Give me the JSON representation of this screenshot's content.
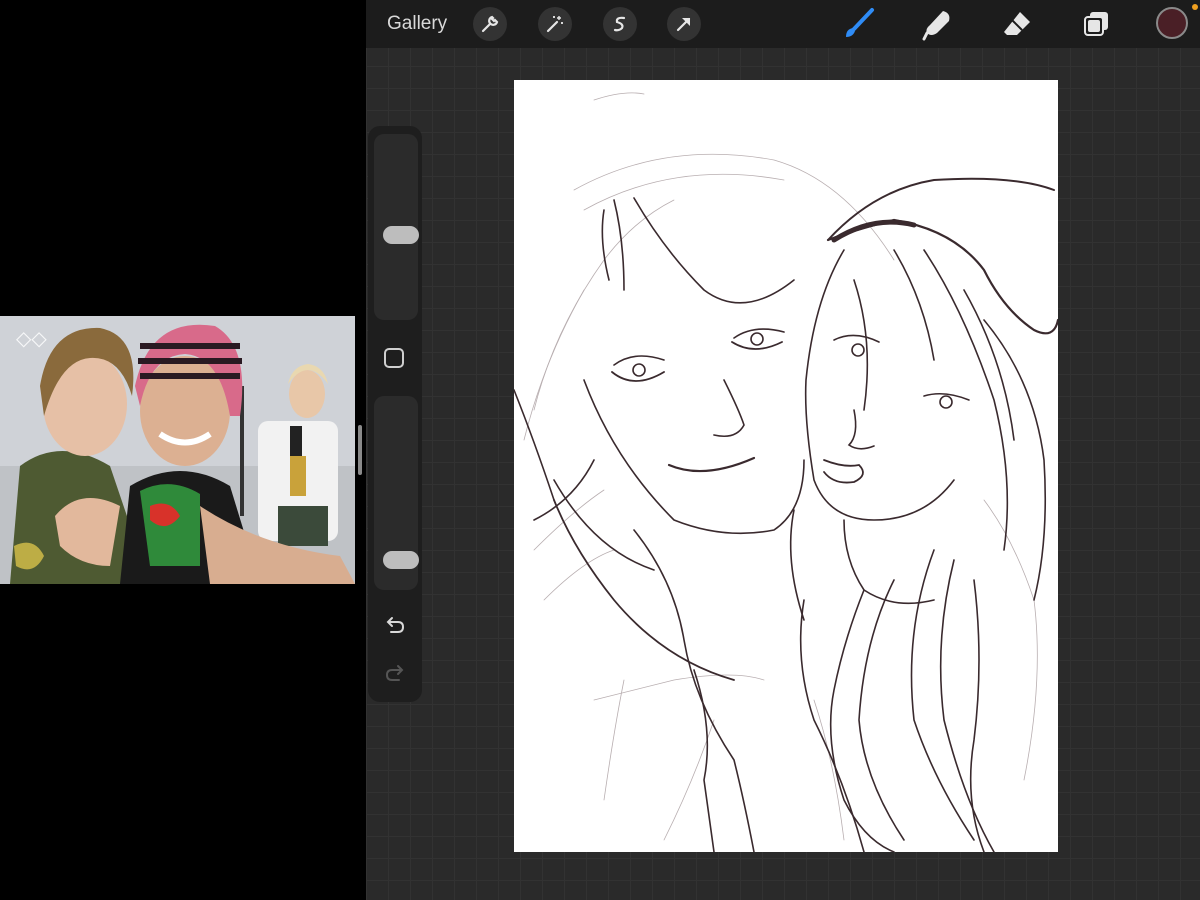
{
  "toolbar": {
    "gallery_label": "Gallery",
    "left_tools": [
      "wrench-icon",
      "magic-wand-icon",
      "selection-icon",
      "transform-arrow-icon"
    ],
    "right_tools": [
      "brush-icon",
      "smudge-icon",
      "eraser-icon",
      "layers-icon"
    ],
    "active_tool": "brush",
    "accent_color": "#2f8cf6",
    "current_color": "#4a1f26"
  },
  "sidebar": {
    "brush_size": 0.45,
    "brush_opacity": 0.1,
    "buttons": [
      "modify-square-icon",
      "undo-icon",
      "redo-icon"
    ]
  },
  "reference": {
    "watermark": "◇◇"
  },
  "canvas": {
    "background": "#ffffff",
    "stroke_color": "#3a2a2e"
  }
}
